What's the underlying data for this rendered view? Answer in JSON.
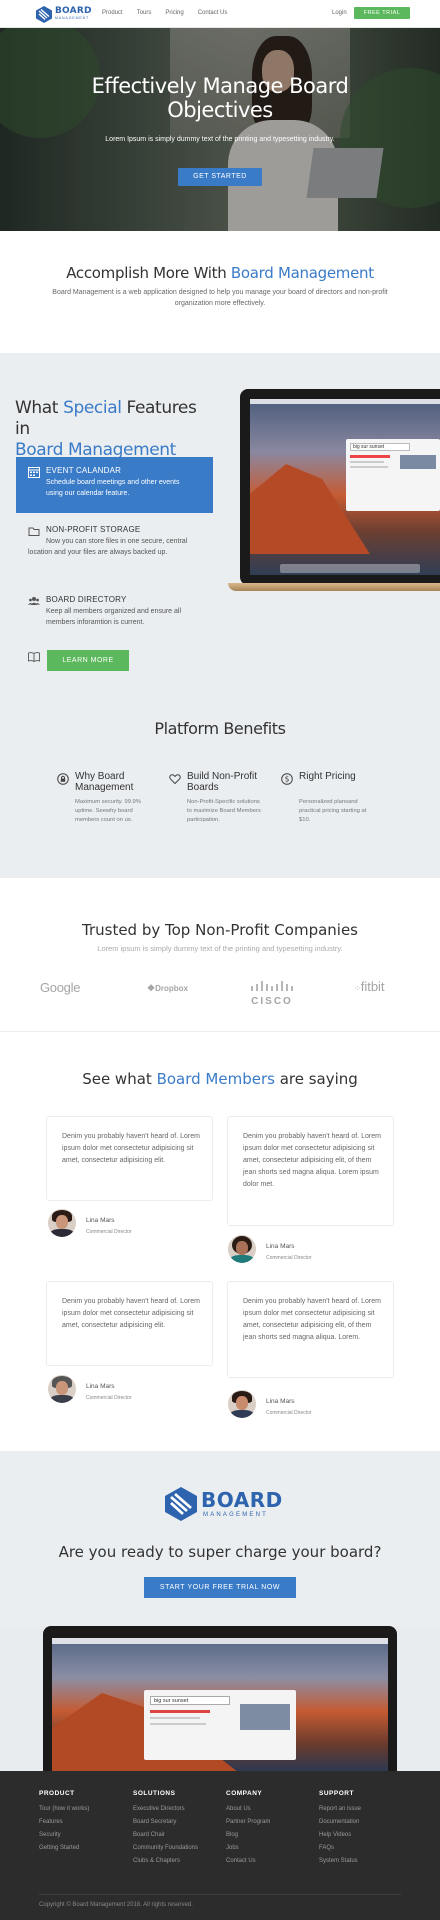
{
  "nav": {
    "logo_main": "BOARD",
    "logo_sub": "MANAGEMENT",
    "items": [
      "Product",
      "Tours",
      "Pricing",
      "Contact Us"
    ],
    "login": "Login",
    "trial": "FREE TRIAL"
  },
  "hero": {
    "title_line1": "Effectively Manage Board",
    "title_line2": "Objectives",
    "subtitle": "Lorem Ipsum is simply dummy text of the printing and typesetting industry.",
    "cta": "GET STARTED"
  },
  "accomplish": {
    "title_prefix": "Accomplish More With ",
    "title_highlight": "Board Management",
    "text": "Board Management is a web application designed to help you manage your board of directors and non-profit organization more effectively."
  },
  "features": {
    "title_1": "What ",
    "title_hl1": "Special",
    "title_2": " Features in",
    "title_hl2": "Board Management",
    "items": [
      {
        "title": "EVENT CALANDAR",
        "desc": "Schedule board meetings and other events using our calendar feature.",
        "icon": "calendar-icon"
      },
      {
        "title": "NON-PROFIT STORAGE",
        "desc": "Now you can store files in one secure, central location and your files are always backed up.",
        "icon": "folder-icon"
      },
      {
        "title": "BOARD DIRECTORY",
        "desc": "Keep all members organized and ensure all members inforamtion is current.",
        "icon": "people-icon"
      }
    ],
    "learn_icon": "book-icon",
    "learn_more": "LEARN MORE",
    "mac_search": "big sur sunset"
  },
  "benefits": {
    "title": "Platform Benefits",
    "items": [
      {
        "title": "Why Board Management",
        "desc": "Maximum security. 99.9% uptime. Seewhy board members count on us.",
        "icon": "lock-icon"
      },
      {
        "title": "Build Non-Profit Boards",
        "desc": "Non-Profit-Specific solutions to maximize Board Members participation.",
        "icon": "heart-icon"
      },
      {
        "title": "Right Pricing",
        "desc": "Personalized plansand practical pricing starting at $10.",
        "icon": "dollar-icon"
      }
    ]
  },
  "trusted": {
    "title": "Trusted by Top Non-Profit Companies",
    "subtitle": "Lorem ipsum is simply dummy text of the printing and typesetting industry.",
    "brands": [
      "Google",
      "Dropbox",
      "cisco",
      "fitbit"
    ]
  },
  "testimonials": {
    "title_prefix": "See what ",
    "title_highlight": "Board Members",
    "title_suffix": " are saying",
    "items": [
      {
        "quote": "Denim you probably haven't heard of. Lorem ipsum dolor met consectetur adipisicing sit amet, consectetur adipisicing elit.",
        "name": "Lina Mars",
        "role": "Commercial Director"
      },
      {
        "quote": "Denim you probably haven't heard of. Lorem ipsum dolor met consectetur adipisicing sit amet, consectetur adipisicing elit, of them jean shorts sed magna aliqua. Lorem ipsum dolor met.",
        "name": "Lina Mars",
        "role": "Commercial Director"
      },
      {
        "quote": "Denim you probably haven't heard of. Lorem ipsum dolor met consectetur adipisicing sit amet, consectetur adipisicing elit.",
        "name": "Lina Mars",
        "role": "Commercial Director"
      },
      {
        "quote": "Denim you probably haven't heard of. Lorem ipsum dolor met consectetur adipisicing sit amet, consectetur adipisicing elit, of them jean shorts sed magna aliqua. Lorem.",
        "name": "Lina Mars",
        "role": "Commercial Director"
      }
    ]
  },
  "cta": {
    "logo_main": "BOARD",
    "logo_sub": "MANAGEMENT",
    "title": "Are you ready to super charge your board?",
    "button": "START YOUR FREE TRIAL NOW"
  },
  "laptop": {
    "search": "big sur sunset"
  },
  "footer": {
    "columns": [
      {
        "title": "PRODUCT",
        "links": [
          "Tour (how it works)",
          "Features",
          "Security",
          "Getting Started"
        ]
      },
      {
        "title": "SOLUTIONS",
        "links": [
          "Executive Directors",
          "Board Secretary",
          "Board Chair",
          "Community Foundations",
          "Clubs & Chapters"
        ]
      },
      {
        "title": "COMPANY",
        "links": [
          "About Us",
          "Partner Program",
          "Blog",
          "Jobs",
          "Contact Us"
        ]
      },
      {
        "title": "SUPPORT",
        "links": [
          "Report an issue",
          "Documentation",
          "Help Videos",
          "FAQs",
          "System Status"
        ]
      }
    ],
    "copyright": "Copyright © Board Management 2018. All rights reserved."
  },
  "colors": {
    "accent": "#3a7bc8",
    "green": "#5cb85c",
    "footer": "#2c2c2c",
    "section_bg": "#eaeef1"
  }
}
